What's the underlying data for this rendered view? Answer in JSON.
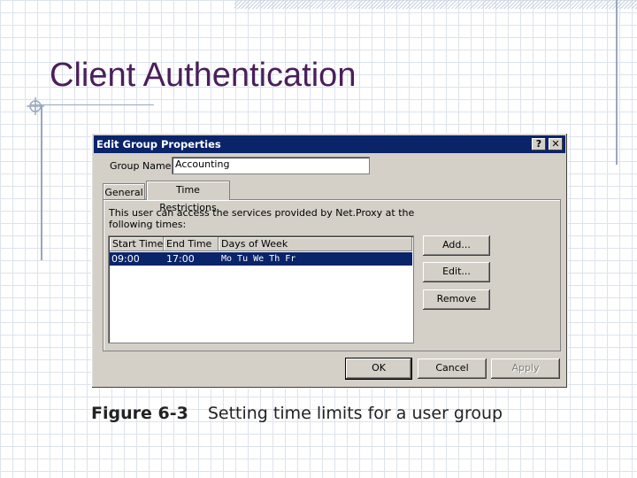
{
  "slide": {
    "title": "Client Authentication"
  },
  "dialog": {
    "title": "Edit Group Properties",
    "help_glyph": "?",
    "close_glyph": "✕",
    "group_name_label": "Group Name:",
    "group_name_value": "Accounting",
    "tabs": [
      {
        "label": "General",
        "active": false
      },
      {
        "label": "Time Restrictions",
        "active": true
      }
    ],
    "description": "This user can access the services provided by Net.Proxy at the following times:",
    "columns": [
      "Start Time",
      "End Time",
      "Days of Week"
    ],
    "rows": [
      {
        "start": "09:00",
        "end": "17:00",
        "days": "Mo Tu We Th Fr",
        "selected": true
      }
    ],
    "side_buttons": {
      "add": "Add...",
      "edit": "Edit...",
      "remove": "Remove"
    },
    "footer_buttons": {
      "ok": "OK",
      "cancel": "Cancel",
      "apply": "Apply"
    }
  },
  "caption": {
    "figure": "Figure 6-3",
    "text": "Setting time limits for a user group"
  },
  "colors": {
    "title_text": "#4a1f5a",
    "dialog_face": "#d4d0c8",
    "titlebar": "#0a246a",
    "selection": "#0a246a"
  }
}
